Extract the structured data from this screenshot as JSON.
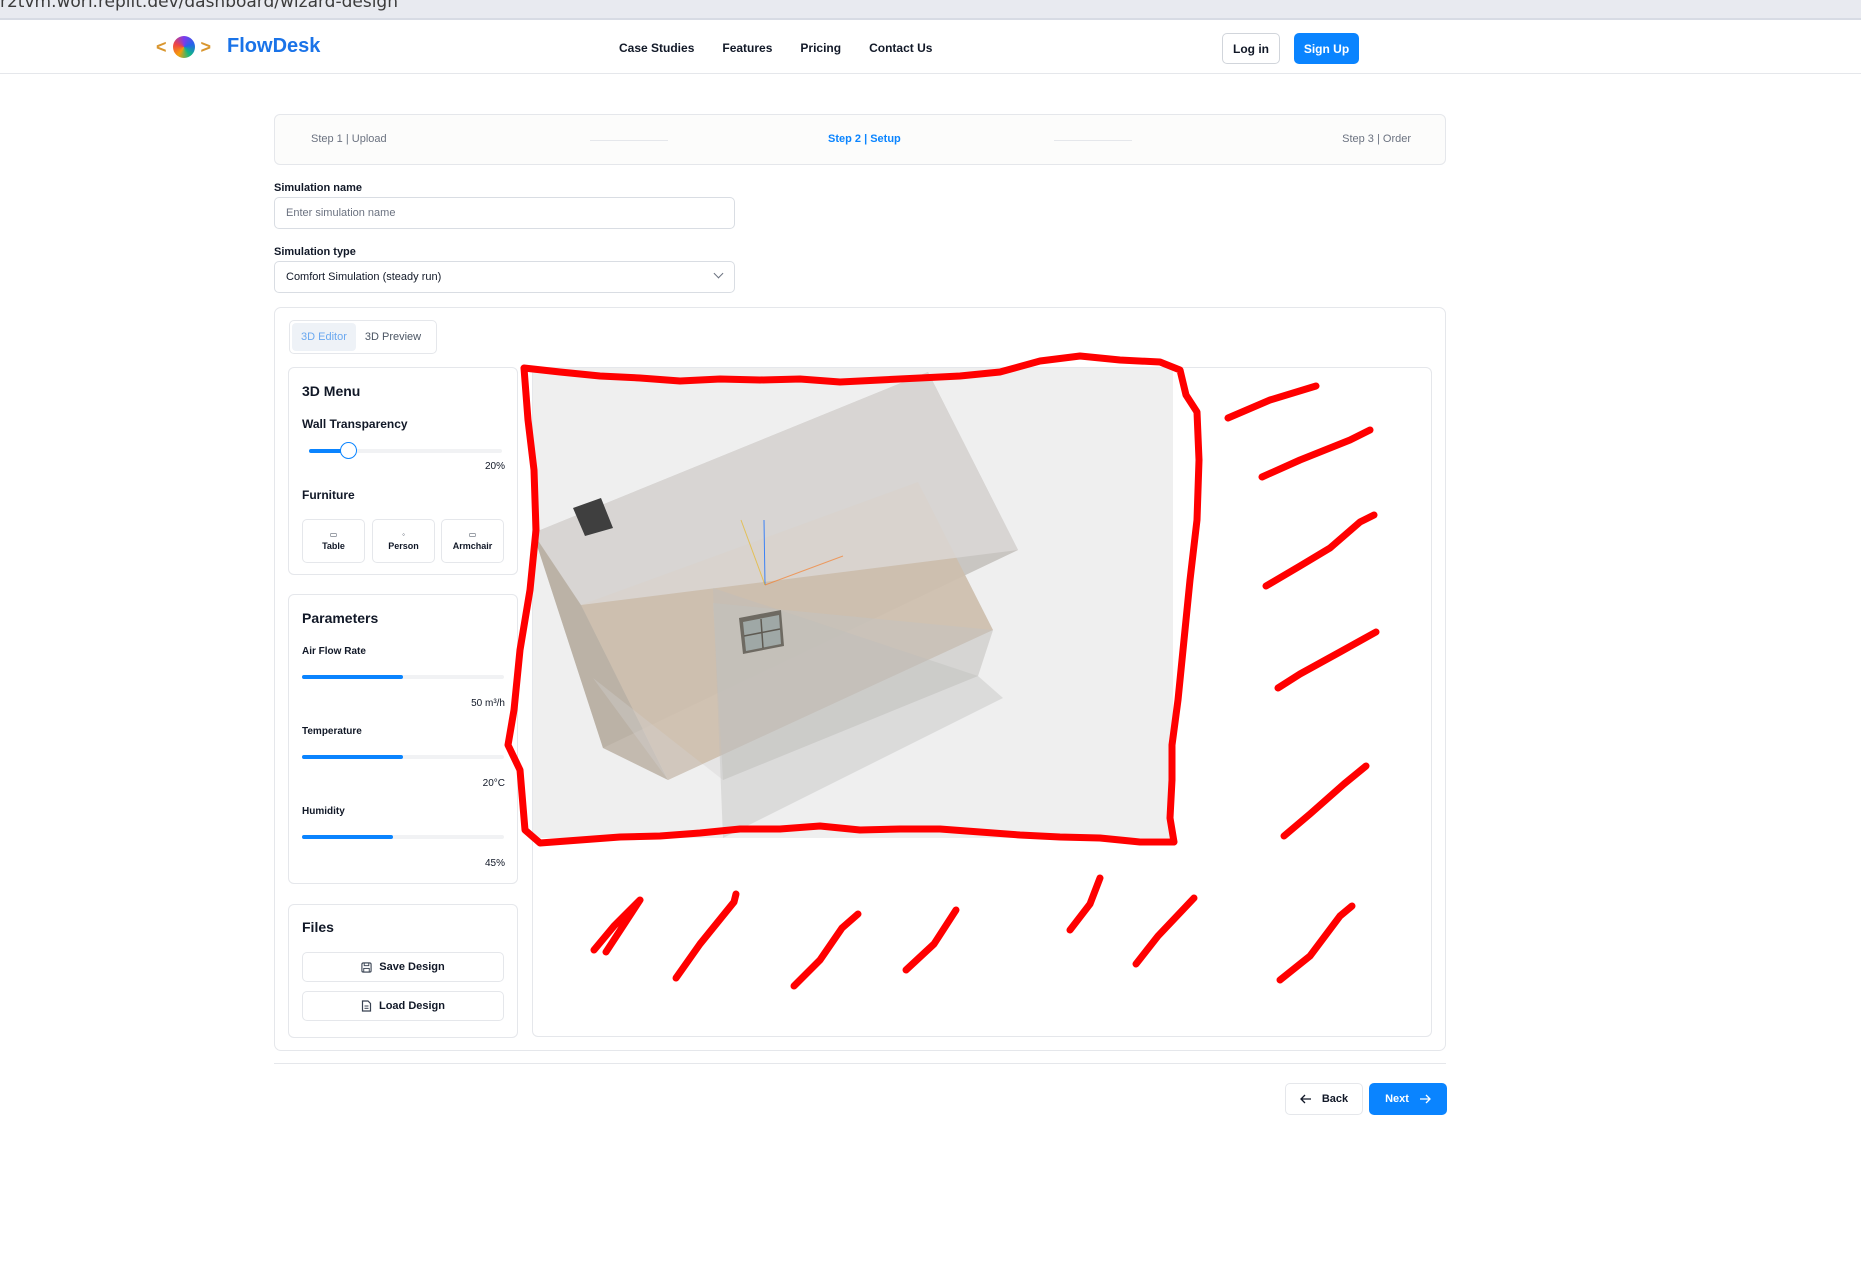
{
  "browser": {
    "url": "r2tvm.worf.replit.dev/dashboard/wizard-design"
  },
  "header": {
    "logo_left": "<",
    "logo_right": ">",
    "brand": "FlowDesk",
    "nav": [
      "Case Studies",
      "Features",
      "Pricing",
      "Contact Us"
    ],
    "login_label": "Log in",
    "signup_label": "Sign Up"
  },
  "stepper": {
    "step1": "Step 1 | Upload",
    "step2": "Step 2 | Setup",
    "step3": "Step 3 | Order",
    "active_step": 2
  },
  "form": {
    "name_label": "Simulation name",
    "name_placeholder": "Enter simulation name",
    "type_label": "Simulation type",
    "type_value": "Comfort Simulation (steady run)"
  },
  "tabs": {
    "editor": "3D Editor",
    "preview": "3D Preview",
    "active": "3D Editor"
  },
  "menu3d": {
    "title": "3D Menu",
    "wall_label": "Wall Transparency",
    "wall_value": "20%",
    "wall_fraction": 0.2,
    "furniture_label": "Furniture",
    "furniture": [
      {
        "label": "Table",
        "icon": "table-icon"
      },
      {
        "label": "Person",
        "icon": "person-icon"
      },
      {
        "label": "Armchair",
        "icon": "armchair-icon"
      }
    ]
  },
  "parameters": {
    "title": "Parameters",
    "items": [
      {
        "label": "Air Flow Rate",
        "value": "50 m³/h",
        "fraction": 0.5
      },
      {
        "label": "Temperature",
        "value": "20°C",
        "fraction": 0.5
      },
      {
        "label": "Humidity",
        "value": "45%",
        "fraction": 0.45
      }
    ]
  },
  "files": {
    "title": "Files",
    "save_label": "Save Design",
    "load_label": "Load Design"
  },
  "footer_nav": {
    "back_label": "Back",
    "next_label": "Next"
  },
  "colors": {
    "accent": "#0a84ff",
    "annotation": "#ff0000",
    "brand": "#1a73e8"
  }
}
